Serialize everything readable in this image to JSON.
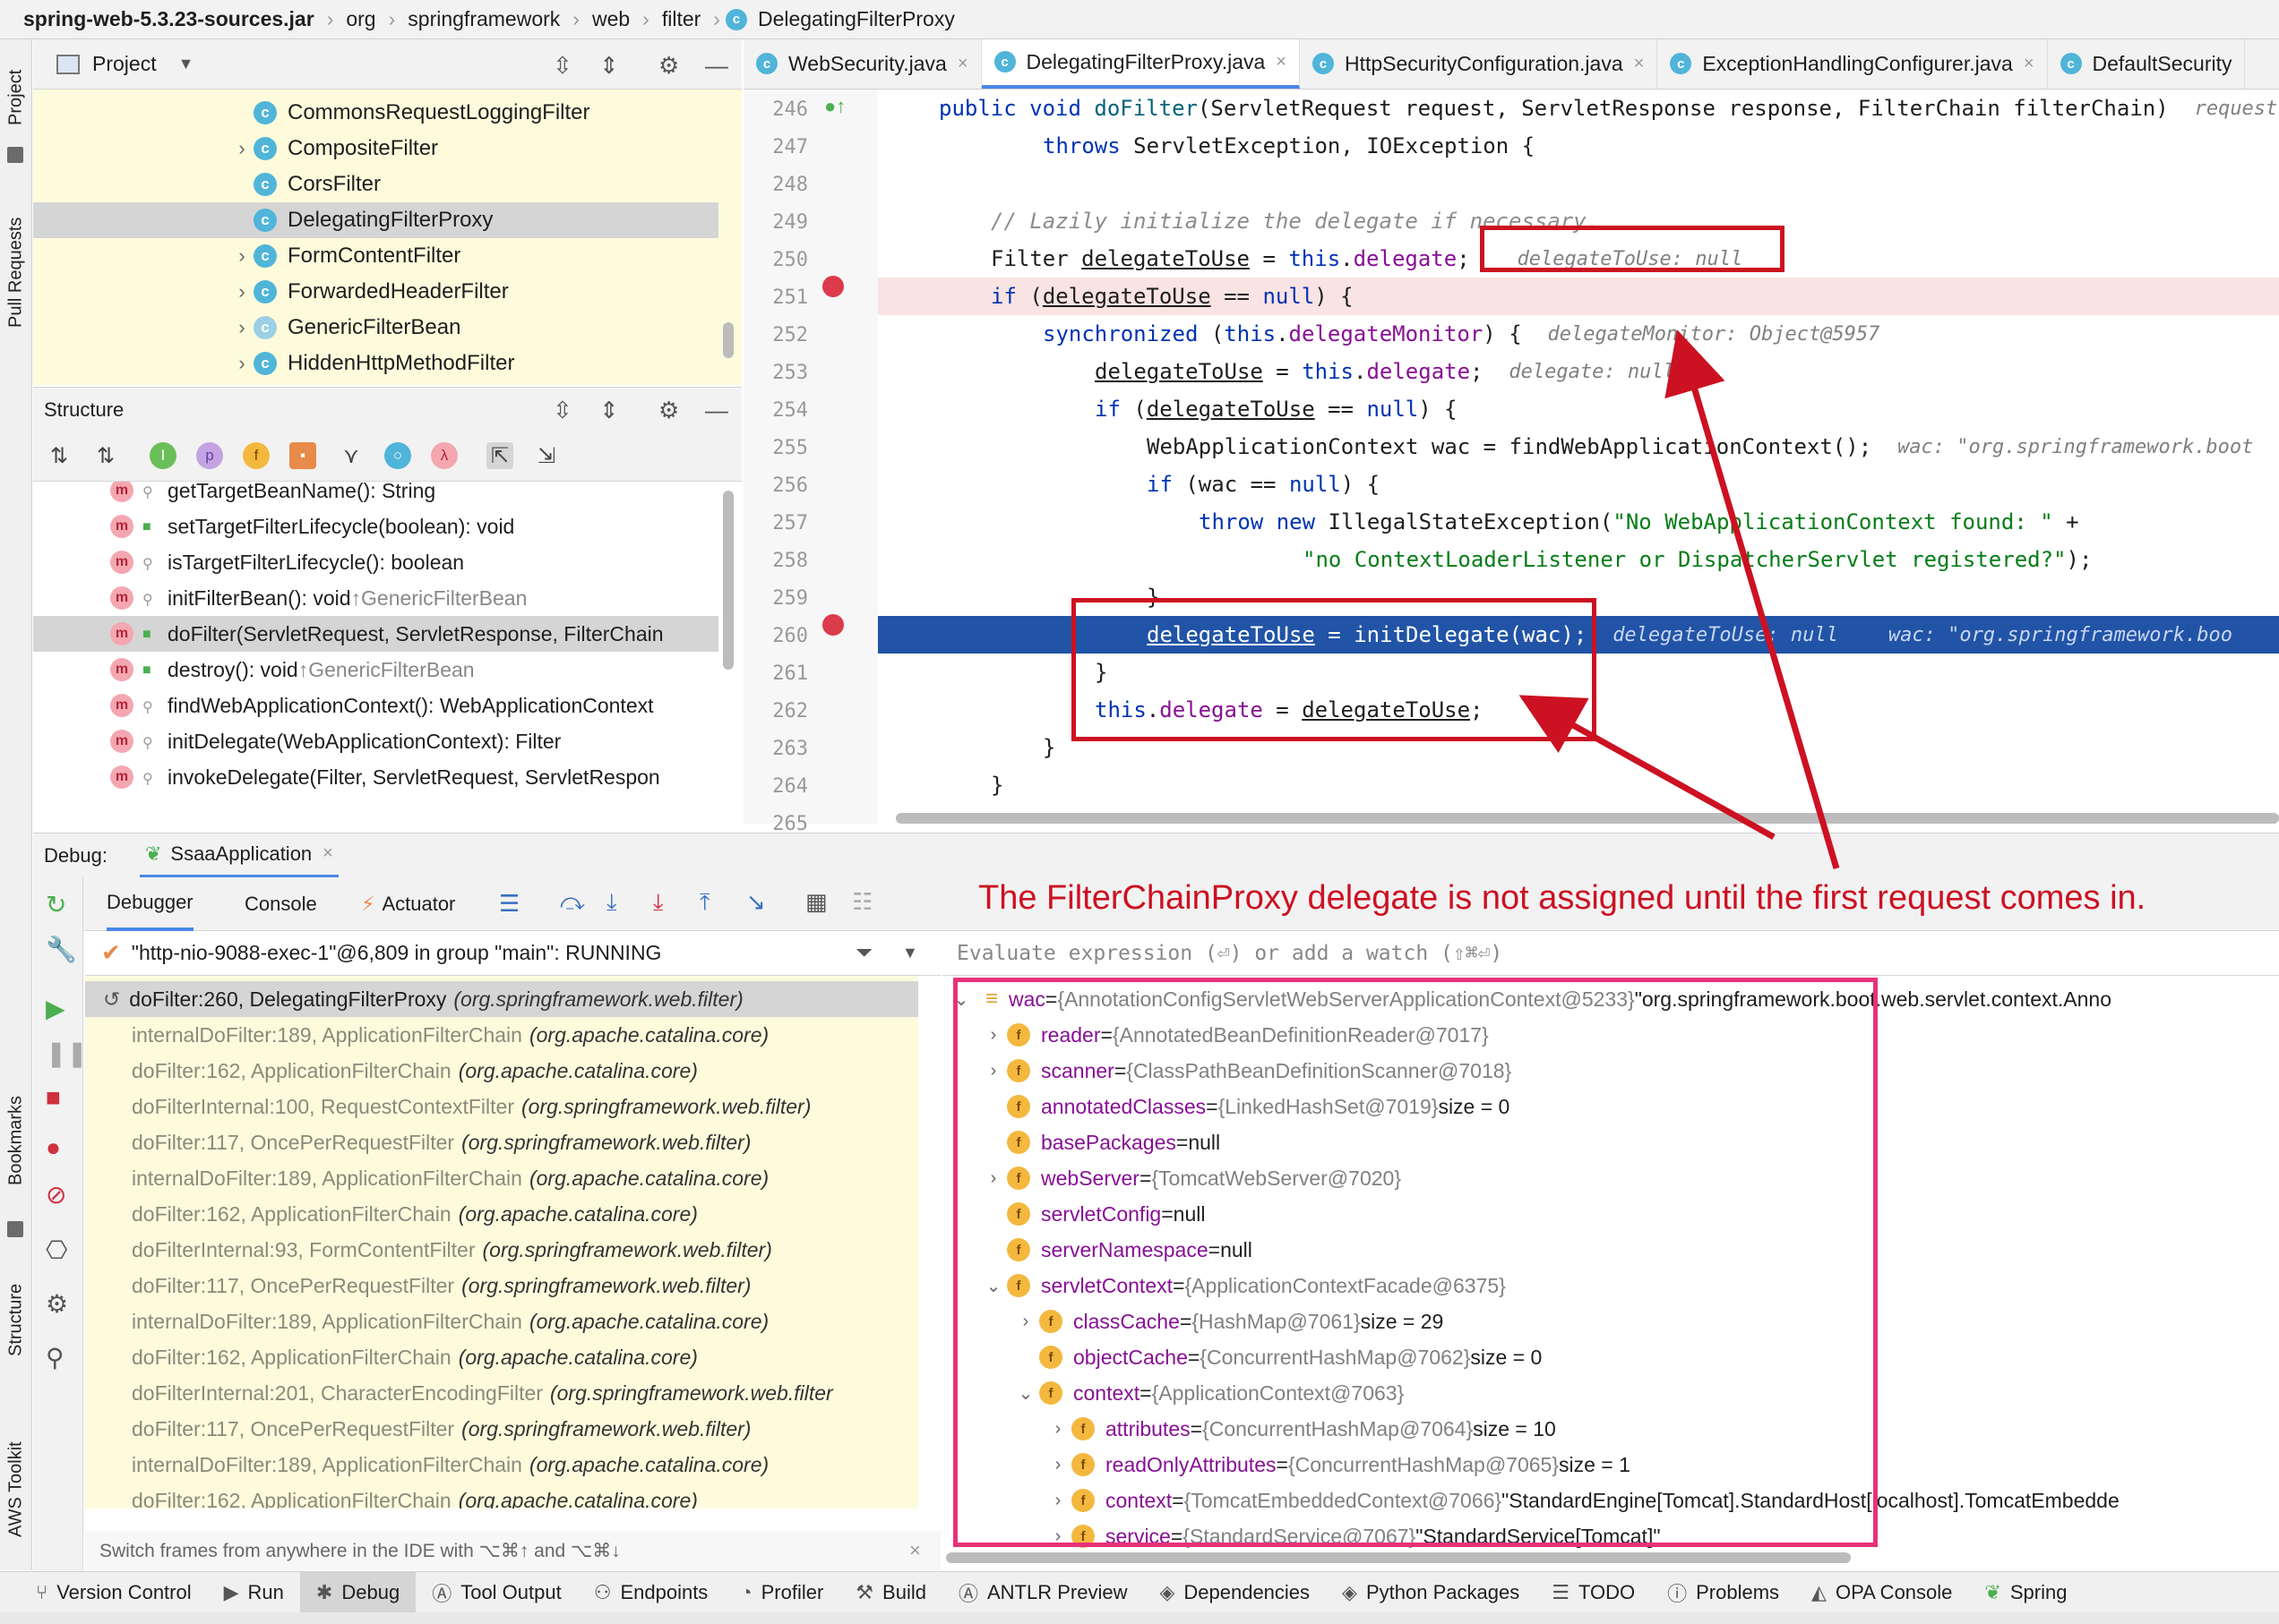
{
  "breadcrumb": [
    "spring-web-5.3.23-sources.jar",
    "org",
    "springframework",
    "web",
    "filter",
    "DelegatingFilterProxy"
  ],
  "left_strip": [
    "Project",
    "Pull Requests",
    "Bookmarks",
    "Structure",
    "AWS Toolkit"
  ],
  "project": {
    "title": "Project",
    "items": [
      {
        "label": "CommonsRequestLoggingFilter",
        "expandable": false
      },
      {
        "label": "CompositeFilter",
        "expandable": true
      },
      {
        "label": "CorsFilter",
        "expandable": false
      },
      {
        "label": "DelegatingFilterProxy",
        "expandable": false,
        "selected": true
      },
      {
        "label": "FormContentFilter",
        "expandable": true
      },
      {
        "label": "ForwardedHeaderFilter",
        "expandable": true
      },
      {
        "label": "GenericFilterBean",
        "expandable": true
      },
      {
        "label": "HiddenHttpMethodFilter",
        "expandable": true
      }
    ]
  },
  "structure": {
    "title": "Structure",
    "items": [
      {
        "name": "getTargetBeanName(): String",
        "inherited": ""
      },
      {
        "name": "setTargetFilterLifecycle(boolean): void",
        "inherited": ""
      },
      {
        "name": "isTargetFilterLifecycle(): boolean",
        "inherited": ""
      },
      {
        "name": "initFilterBean(): void ",
        "inherited": "↑GenericFilterBean"
      },
      {
        "name": "doFilter(ServletRequest, ServletResponse, FilterChain",
        "inherited": "",
        "selected": true
      },
      {
        "name": "destroy(): void ",
        "inherited": "↑GenericFilterBean"
      },
      {
        "name": "findWebApplicationContext(): WebApplicationContext",
        "inherited": ""
      },
      {
        "name": "initDelegate(WebApplicationContext): Filter",
        "inherited": ""
      },
      {
        "name": "invokeDelegate(Filter, ServletRequest, ServletRespon",
        "inherited": ""
      }
    ]
  },
  "editor": {
    "tabs": [
      "WebSecurity.java",
      "DelegatingFilterProxy.java",
      "HttpSecurityConfiguration.java",
      "ExceptionHandlingConfigurer.java",
      "DefaultSecurity"
    ],
    "active_tab": 1,
    "line_numbers": [
      "246",
      "247",
      "248",
      "249",
      "250",
      "251",
      "252",
      "253",
      "254",
      "255",
      "256",
      "257",
      "258",
      "259",
      "260",
      "261",
      "262",
      "263",
      "264",
      "265"
    ],
    "hints": {
      "l246": "request",
      "l250": "delegateToUse: null",
      "l252": "delegateMonitor: Object@5957",
      "l253": "delegate: null",
      "l255": "wac: \"org.springframework.boot",
      "l260a": "delegateToUse: null",
      "l260b": "wac: \"org.springframework.boo"
    },
    "strings": {
      "s257": "\"No WebApplicationContext found: \"",
      "s258": "\"no ContextLoaderListener or DispatcherServlet registered?\""
    }
  },
  "debug": {
    "label": "Debug:",
    "session": "SsaaApplication",
    "tabs": [
      "Debugger",
      "Console",
      "Actuator"
    ],
    "thread": "\"http-nio-9088-exec-1\"@6,809 in group \"main\": RUNNING",
    "frames": [
      {
        "method": "doFilter:260, DelegatingFilterProxy",
        "pkg": "(org.springframework.web.filter)"
      },
      {
        "method": "internalDoFilter:189, ApplicationFilterChain",
        "pkg": "(org.apache.catalina.core)"
      },
      {
        "method": "doFilter:162, ApplicationFilterChain",
        "pkg": "(org.apache.catalina.core)"
      },
      {
        "method": "doFilterInternal:100, RequestContextFilter",
        "pkg": "(org.springframework.web.filter)"
      },
      {
        "method": "doFilter:117, OncePerRequestFilter",
        "pkg": "(org.springframework.web.filter)"
      },
      {
        "method": "internalDoFilter:189, ApplicationFilterChain",
        "pkg": "(org.apache.catalina.core)"
      },
      {
        "method": "doFilter:162, ApplicationFilterChain",
        "pkg": "(org.apache.catalina.core)"
      },
      {
        "method": "doFilterInternal:93, FormContentFilter",
        "pkg": "(org.springframework.web.filter)"
      },
      {
        "method": "doFilter:117, OncePerRequestFilter",
        "pkg": "(org.springframework.web.filter)"
      },
      {
        "method": "internalDoFilter:189, ApplicationFilterChain",
        "pkg": "(org.apache.catalina.core)"
      },
      {
        "method": "doFilter:162, ApplicationFilterChain",
        "pkg": "(org.apache.catalina.core)"
      },
      {
        "method": "doFilterInternal:201, CharacterEncodingFilter",
        "pkg": "(org.springframework.web.filter"
      },
      {
        "method": "doFilter:117, OncePerRequestFilter",
        "pkg": "(org.springframework.web.filter)"
      },
      {
        "method": "internalDoFilter:189, ApplicationFilterChain",
        "pkg": "(org.apache.catalina.core)"
      },
      {
        "method": "doFilter:162, ApplicationFilterChain",
        "pkg": "(org.apache.catalina.core)"
      }
    ],
    "frames_hint": "Switch frames from anywhere in the IDE with ⌥⌘↑ and ⌥⌘↓",
    "eval_placeholder": "Evaluate expression (⏎) or add a watch (⇧⌘⏎)",
    "variables": [
      {
        "indent": 0,
        "chev": "v",
        "icon": "≡",
        "name": "wac",
        "type": "{AnnotationConfigServletWebServerApplicationContext@5233}",
        "extra": " \"org.springframework.boot.web.servlet.context.Anno"
      },
      {
        "indent": 1,
        "chev": ">",
        "icon": "f",
        "name": "reader",
        "type": "{AnnotatedBeanDefinitionReader@7017}",
        "extra": ""
      },
      {
        "indent": 1,
        "chev": ">",
        "icon": "f",
        "name": "scanner",
        "type": "{ClassPathBeanDefinitionScanner@7018}",
        "extra": ""
      },
      {
        "indent": 1,
        "chev": "",
        "icon": "f",
        "name": "annotatedClasses",
        "type": "{LinkedHashSet@7019}",
        "extra": "  size = 0"
      },
      {
        "indent": 1,
        "chev": "",
        "icon": "f",
        "name": "basePackages",
        "type": "",
        "extra": "null"
      },
      {
        "indent": 1,
        "chev": ">",
        "icon": "f",
        "name": "webServer",
        "type": "{TomcatWebServer@7020}",
        "extra": ""
      },
      {
        "indent": 1,
        "chev": "",
        "icon": "f",
        "name": "servletConfig",
        "type": "",
        "extra": "null"
      },
      {
        "indent": 1,
        "chev": "",
        "icon": "f",
        "name": "serverNamespace",
        "type": "",
        "extra": "null"
      },
      {
        "indent": 1,
        "chev": "v",
        "icon": "f",
        "name": "servletContext",
        "type": "{ApplicationContextFacade@6375}",
        "extra": ""
      },
      {
        "indent": 2,
        "chev": ">",
        "icon": "f",
        "name": "classCache",
        "type": "{HashMap@7061}",
        "extra": "  size = 29"
      },
      {
        "indent": 2,
        "chev": "",
        "icon": "f",
        "name": "objectCache",
        "type": "{ConcurrentHashMap@7062}",
        "extra": "  size = 0"
      },
      {
        "indent": 2,
        "chev": "v",
        "icon": "f",
        "name": "context",
        "type": "{ApplicationContext@7063}",
        "extra": ""
      },
      {
        "indent": 3,
        "chev": ">",
        "icon": "f",
        "name": "attributes",
        "type": "{ConcurrentHashMap@7064}",
        "extra": "  size = 10"
      },
      {
        "indent": 3,
        "chev": ">",
        "icon": "f",
        "name": "readOnlyAttributes",
        "type": "{ConcurrentHashMap@7065}",
        "extra": "  size = 1"
      },
      {
        "indent": 3,
        "chev": ">",
        "icon": "f",
        "name": "context",
        "type": "{TomcatEmbeddedContext@7066}",
        "extra": " \"StandardEngine[Tomcat].StandardHost[localhost].TomcatEmbedde"
      },
      {
        "indent": 3,
        "chev": ">",
        "icon": "f",
        "name": "service",
        "type": "{StandardService@7067}",
        "extra": " \"StandardService[Tomcat]\""
      }
    ]
  },
  "annotation": "The FilterChainProxy delegate is not assigned until the first request comes in.",
  "bottom_bar": [
    "Version Control",
    "Run",
    "Debug",
    "Tool Output",
    "Endpoints",
    "Profiler",
    "Build",
    "ANTLR Preview",
    "Dependencies",
    "Python Packages",
    "TODO",
    "Problems",
    "OPA Console",
    "Spring"
  ],
  "bottom_active": "Debug",
  "colors": {
    "accent": "#4a86e8",
    "annotation_red": "#cc1122",
    "annotation_pink": "#e8317a",
    "current_line": "#2154a6",
    "breakpoint_line": "#fae3e3"
  }
}
